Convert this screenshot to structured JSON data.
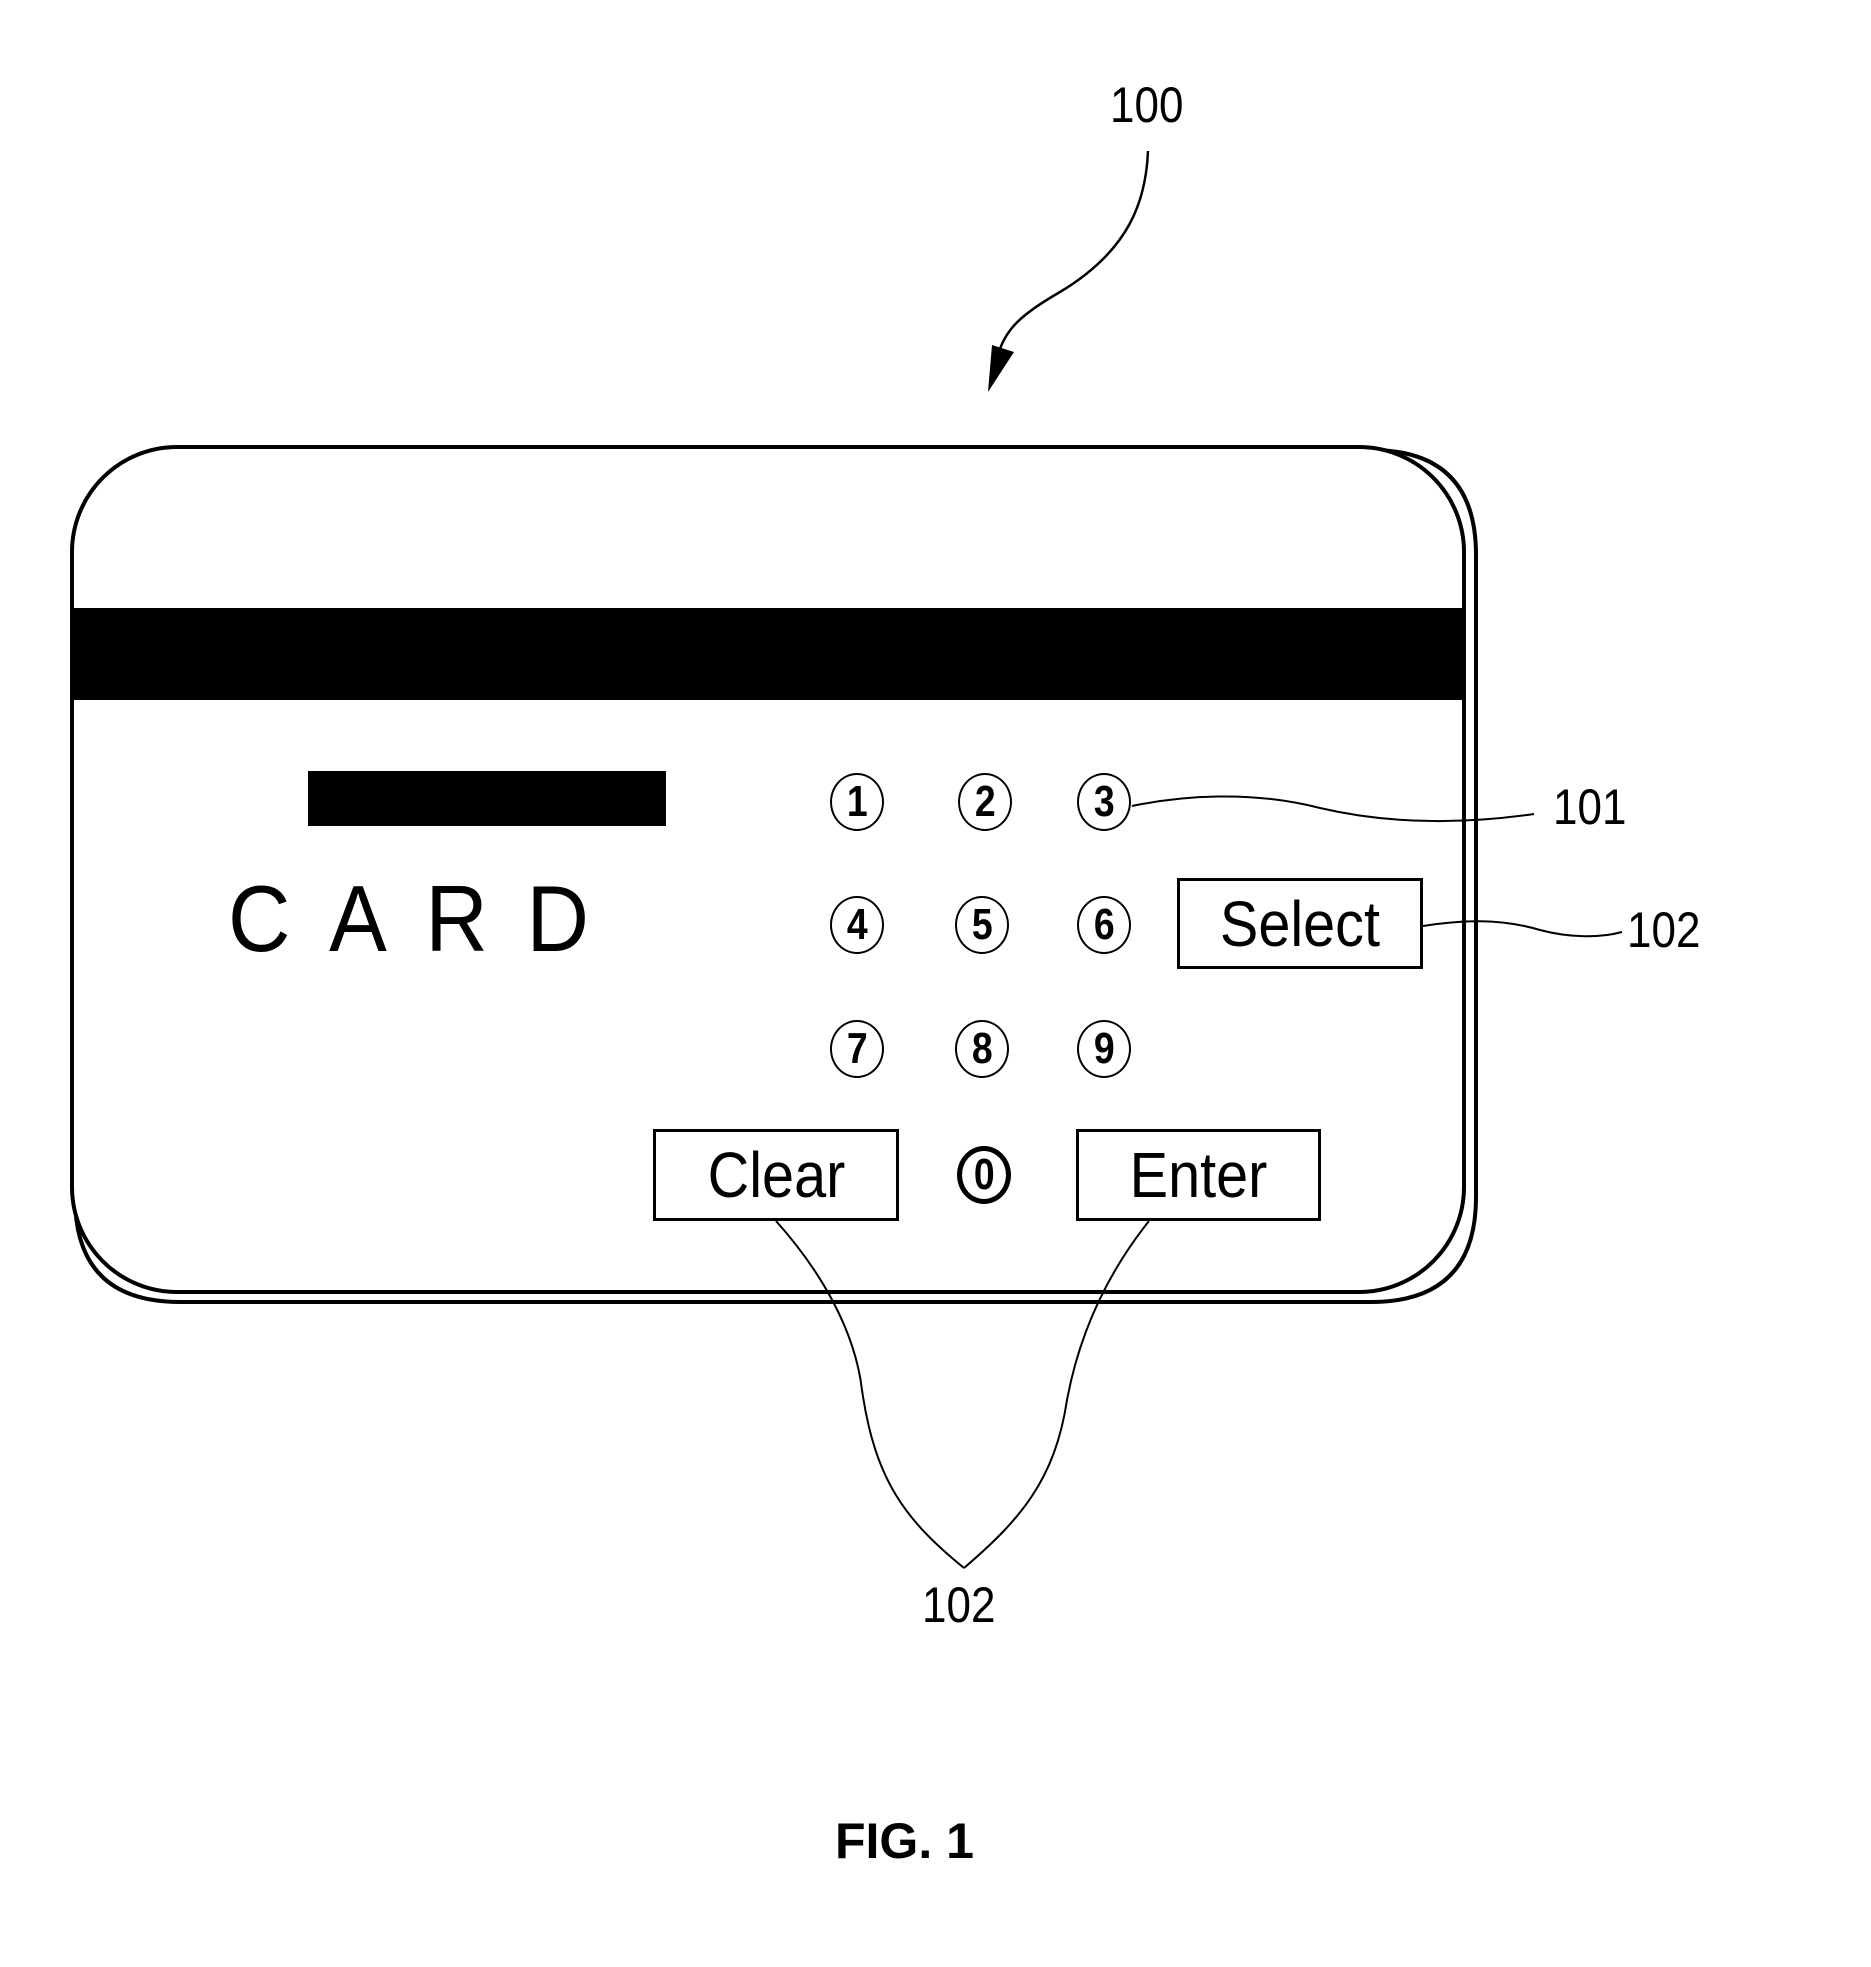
{
  "figure": {
    "caption": "FIG. 1",
    "colors": {
      "ink": "#000000",
      "paper": "#ffffff"
    }
  },
  "card": {
    "ref_number": "100",
    "label": "CARD",
    "magnetic_stripe": true,
    "display_block": true,
    "keypad": {
      "ref_number": "101",
      "keys": [
        {
          "label": "1",
          "glyph": "circled-digit-1"
        },
        {
          "label": "2",
          "glyph": "circled-digit-2"
        },
        {
          "label": "3",
          "glyph": "circled-digit-3"
        },
        {
          "label": "4",
          "glyph": "circled-digit-4"
        },
        {
          "label": "5",
          "glyph": "circled-digit-5"
        },
        {
          "label": "6",
          "glyph": "circled-digit-6"
        },
        {
          "label": "7",
          "glyph": "circled-digit-7"
        },
        {
          "label": "8",
          "glyph": "circled-digit-8"
        },
        {
          "label": "9",
          "glyph": "circled-digit-9"
        },
        {
          "label": "0",
          "glyph": "double-circled-digit-0"
        }
      ]
    },
    "function_buttons": {
      "ref_number": "102",
      "select_label": "Select",
      "clear_label": "Clear",
      "enter_label": "Enter"
    }
  },
  "annotations": {
    "card_ref": "100",
    "keypad_ref": "101",
    "select_ref": "102",
    "clear_enter_ref": "102"
  }
}
